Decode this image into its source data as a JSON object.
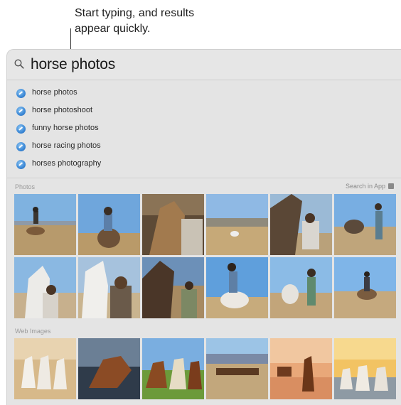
{
  "callout": {
    "line1": "Start typing, and results",
    "line2": "appear quickly."
  },
  "search": {
    "query": "horse photos",
    "icon": "magnifying-glass-icon"
  },
  "suggestions": [
    {
      "label": "horse photos",
      "icon": "safari-compass-icon"
    },
    {
      "label": "horse photoshoot",
      "icon": "safari-compass-icon"
    },
    {
      "label": "funny horse photos",
      "icon": "safari-compass-icon"
    },
    {
      "label": "horse racing photos",
      "icon": "safari-compass-icon"
    },
    {
      "label": "horses photography",
      "icon": "safari-compass-icon"
    }
  ],
  "photos_section": {
    "title": "Photos",
    "search_in_app": "Search in App"
  },
  "web_images_section": {
    "title": "Web Images"
  },
  "colors": {
    "panel_bg": "#e4e4e4",
    "accent_blue": "#3b88d6"
  }
}
